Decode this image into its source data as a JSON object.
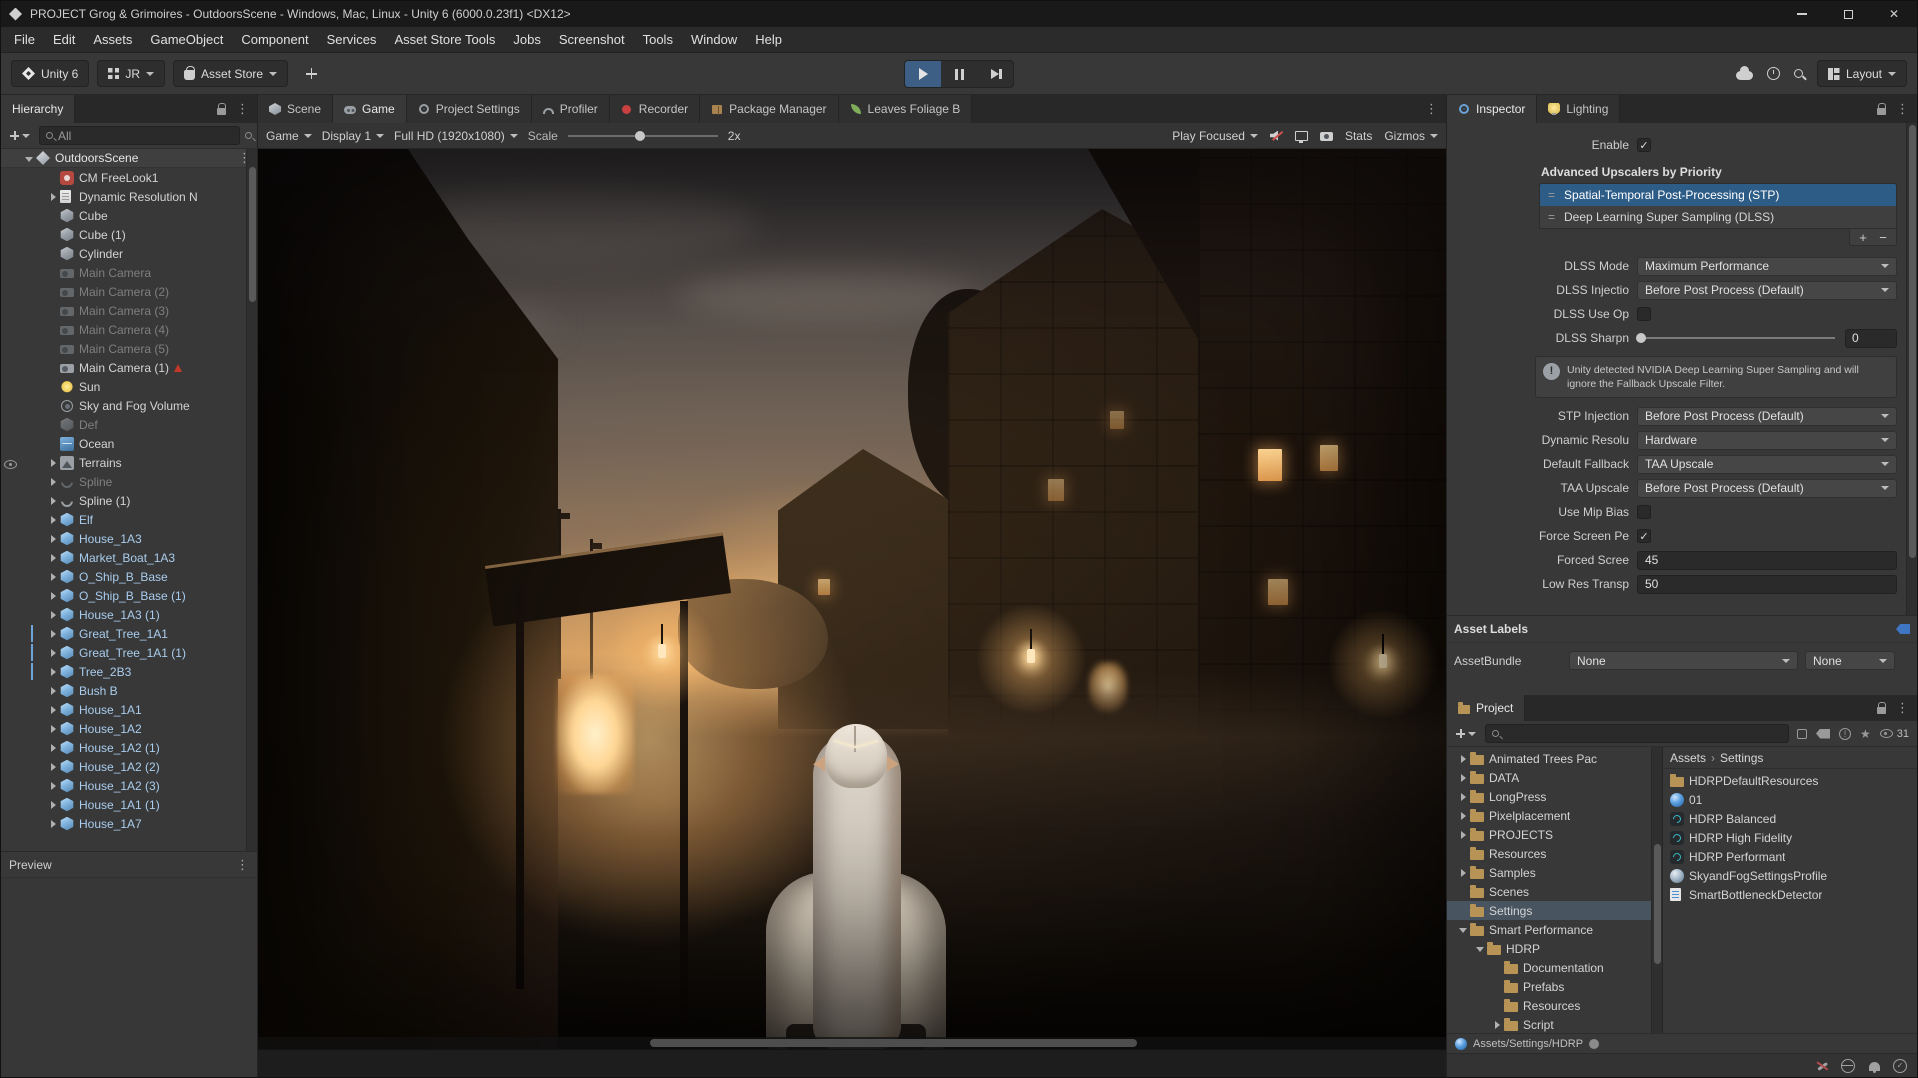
{
  "window": {
    "title": "PROJECT Grog & Grimoires - OutdoorsScene - Windows, Mac, Linux - Unity 6 (6000.0.23f1) <DX12>"
  },
  "menubar": {
    "items": [
      "File",
      "Edit",
      "Assets",
      "GameObject",
      "Component",
      "Services",
      "Asset Store Tools",
      "Jobs",
      "Screenshot",
      "Tools",
      "Window",
      "Help"
    ]
  },
  "toolbar": {
    "version_badge": "Unity 6",
    "account_label": "JR",
    "asset_store_label": "Asset Store",
    "layout_label": "Layout"
  },
  "hierarchy": {
    "tab": "Hierarchy",
    "search_text": "All",
    "scene": "OutdoorsScene",
    "preview_header": "Preview",
    "items": [
      {
        "label": "CM FreeLook1",
        "icon": "cm"
      },
      {
        "label": "Dynamic Resolution N",
        "icon": "script",
        "expand": true
      },
      {
        "label": "Cube",
        "icon": "cube"
      },
      {
        "label": "Cube (1)",
        "icon": "cube"
      },
      {
        "label": "Cylinder",
        "icon": "cube"
      },
      {
        "label": "Main Camera",
        "icon": "camera",
        "dim": true
      },
      {
        "label": "Main Camera (2)",
        "icon": "camera",
        "dim": true
      },
      {
        "label": "Main Camera (3)",
        "icon": "camera",
        "dim": true
      },
      {
        "label": "Main Camera (4)",
        "icon": "camera",
        "dim": true
      },
      {
        "label": "Main Camera (5)",
        "icon": "camera",
        "dim": true
      },
      {
        "label": "Main Camera (1)",
        "icon": "camera",
        "badge": true
      },
      {
        "label": "Sun",
        "icon": "light"
      },
      {
        "label": "Sky and Fog Volume",
        "icon": "volume"
      },
      {
        "label": "Def",
        "icon": "cube",
        "dim": true
      },
      {
        "label": "Ocean",
        "icon": "water"
      },
      {
        "label": "Terrains",
        "icon": "terrain",
        "expand": true,
        "eye": true
      },
      {
        "label": "Spline",
        "icon": "spline",
        "dim": true,
        "expand": true
      },
      {
        "label": "Spline (1)",
        "icon": "spline",
        "expand": true
      },
      {
        "label": "Elf",
        "icon": "prefab",
        "expand": true,
        "more": true
      },
      {
        "label": "House_1A3",
        "icon": "prefab",
        "expand": true,
        "more": true
      },
      {
        "label": "Market_Boat_1A3",
        "icon": "prefab",
        "expand": true,
        "more": true
      },
      {
        "label": "O_Ship_B_Base",
        "icon": "prefab",
        "expand": true,
        "more": true
      },
      {
        "label": "O_Ship_B_Base (1)",
        "icon": "prefab",
        "expand": true,
        "more": true
      },
      {
        "label": "House_1A3 (1)",
        "icon": "prefab",
        "expand": true,
        "more": true
      },
      {
        "label": "Great_Tree_1A1",
        "icon": "prefab",
        "expand": true,
        "more": true,
        "bar": true
      },
      {
        "label": "Great_Tree_1A1 (1)",
        "icon": "prefab",
        "expand": true,
        "more": true,
        "bar": true
      },
      {
        "label": "Tree_2B3",
        "icon": "prefab",
        "expand": true,
        "more": true,
        "bar": true
      },
      {
        "label": "Bush B",
        "icon": "prefab",
        "expand": true,
        "more": true
      },
      {
        "label": "House_1A1",
        "icon": "prefab",
        "expand": true,
        "more": true
      },
      {
        "label": "House_1A2",
        "icon": "prefab",
        "expand": true,
        "more": true
      },
      {
        "label": "House_1A2 (1)",
        "icon": "prefab",
        "expand": true,
        "more": true
      },
      {
        "label": "House_1A2 (2)",
        "icon": "prefab",
        "expand": true,
        "more": true
      },
      {
        "label": "House_1A2 (3)",
        "icon": "prefab",
        "expand": true,
        "more": true
      },
      {
        "label": "House_1A1 (1)",
        "icon": "prefab",
        "expand": true,
        "more": true
      },
      {
        "label": "House_1A7",
        "icon": "prefab",
        "expand": true,
        "more": true
      }
    ]
  },
  "center": {
    "tabs": [
      {
        "label": "Scene",
        "icon": "scene"
      },
      {
        "label": "Game",
        "icon": "game",
        "active": true
      },
      {
        "label": "Project Settings",
        "icon": "gear"
      },
      {
        "label": "Profiler",
        "icon": "gauge"
      },
      {
        "label": "Recorder",
        "icon": "record"
      },
      {
        "label": "Package Manager",
        "icon": "package"
      },
      {
        "label": "Leaves Foliage B",
        "icon": "leaf"
      }
    ],
    "game_toolbar": {
      "mode": "Game",
      "display": "Display 1",
      "resolution": "Full HD (1920x1080)",
      "scale_label": "Scale",
      "scale_value": "2x",
      "play_focused": "Play Focused",
      "stats_label": "Stats",
      "gizmos_label": "Gizmos"
    }
  },
  "inspector": {
    "tabs": [
      "Inspector",
      "Lighting"
    ],
    "enable_label": "Enable",
    "upscalers": {
      "header": "Advanced Upscalers by Priority",
      "items": [
        "Spatial-Temporal Post-Processing (STP)",
        "Deep Learning Super Sampling (DLSS)"
      ],
      "selected": 0
    },
    "fields": [
      {
        "label": "DLSS Mode",
        "type": "dropdown",
        "value": "Maximum Performance"
      },
      {
        "label": "DLSS Injectio",
        "type": "dropdown",
        "value": "Before Post Process (Default)"
      },
      {
        "label": "DLSS Use Op",
        "type": "checkbox",
        "checked": false
      },
      {
        "label": "DLSS Sharpn",
        "type": "slider",
        "value": "0"
      },
      {
        "label": "STP Injection",
        "type": "dropdown",
        "value": "Before Post Process (Default)"
      },
      {
        "label": "Dynamic Resolu",
        "type": "dropdown",
        "value": "Hardware"
      },
      {
        "label": "Default Fallback",
        "type": "dropdown",
        "value": "TAA Upscale"
      },
      {
        "label": "TAA Upscale",
        "type": "dropdown",
        "value": "Before Post Process (Default)"
      },
      {
        "label": "Use Mip Bias",
        "type": "checkbox",
        "checked": false
      },
      {
        "label": "Force Screen Pe",
        "type": "checkbox",
        "checked": true
      },
      {
        "label": "Forced Scree",
        "type": "input",
        "value": "45"
      },
      {
        "label": "Low Res Transp",
        "type": "input",
        "value": "50"
      }
    ],
    "info_text": "Unity detected NVIDIA Deep Learning Super Sampling and will ignore the Fallback Upscale Filter.",
    "asset_labels_header": "Asset Labels",
    "assetbundle_label": "AssetBundle",
    "assetbundle_values": [
      "None",
      "None"
    ]
  },
  "project": {
    "tab": "Project",
    "hidden_count": "31",
    "breadcrumb": [
      "Assets",
      "Settings"
    ],
    "folders": [
      {
        "label": "Animated Trees Pac",
        "depth": 0,
        "arrow": "right"
      },
      {
        "label": "DATA",
        "depth": 0,
        "arrow": "right"
      },
      {
        "label": "LongPress",
        "depth": 0,
        "arrow": "right"
      },
      {
        "label": "Pixelplacement",
        "depth": 0,
        "arrow": "right"
      },
      {
        "label": "PROJECTS",
        "depth": 0,
        "arrow": "right"
      },
      {
        "label": "Resources",
        "depth": 0,
        "arrow": "none"
      },
      {
        "label": "Samples",
        "depth": 0,
        "arrow": "right"
      },
      {
        "label": "Scenes",
        "depth": 0,
        "arrow": "none"
      },
      {
        "label": "Settings",
        "depth": 0,
        "arrow": "none",
        "selected": true
      },
      {
        "label": "Smart Performance",
        "depth": 0,
        "arrow": "down"
      },
      {
        "label": "HDRP",
        "depth": 1,
        "arrow": "down"
      },
      {
        "label": "Documentation",
        "depth": 2,
        "arrow": "none"
      },
      {
        "label": "Prefabs",
        "depth": 2,
        "arrow": "none"
      },
      {
        "label": "Resources",
        "depth": 2,
        "arrow": "none"
      },
      {
        "label": "Script",
        "depth": 2,
        "arrow": "right"
      }
    ],
    "files": [
      {
        "label": "HDRPDefaultResources",
        "icon": "folder"
      },
      {
        "label": "01",
        "icon": "sphere"
      },
      {
        "label": "HDRP Balanced",
        "icon": "hdrp"
      },
      {
        "label": "HDRP High Fidelity",
        "icon": "hdrp"
      },
      {
        "label": "HDRP Performant",
        "icon": "hdrp"
      },
      {
        "label": "SkyandFogSettingsProfile",
        "icon": "profile"
      },
      {
        "label": "SmartBottleneckDetector",
        "icon": "page"
      }
    ]
  },
  "statusbar": {
    "path": "Assets/Settings/HDRP"
  }
}
